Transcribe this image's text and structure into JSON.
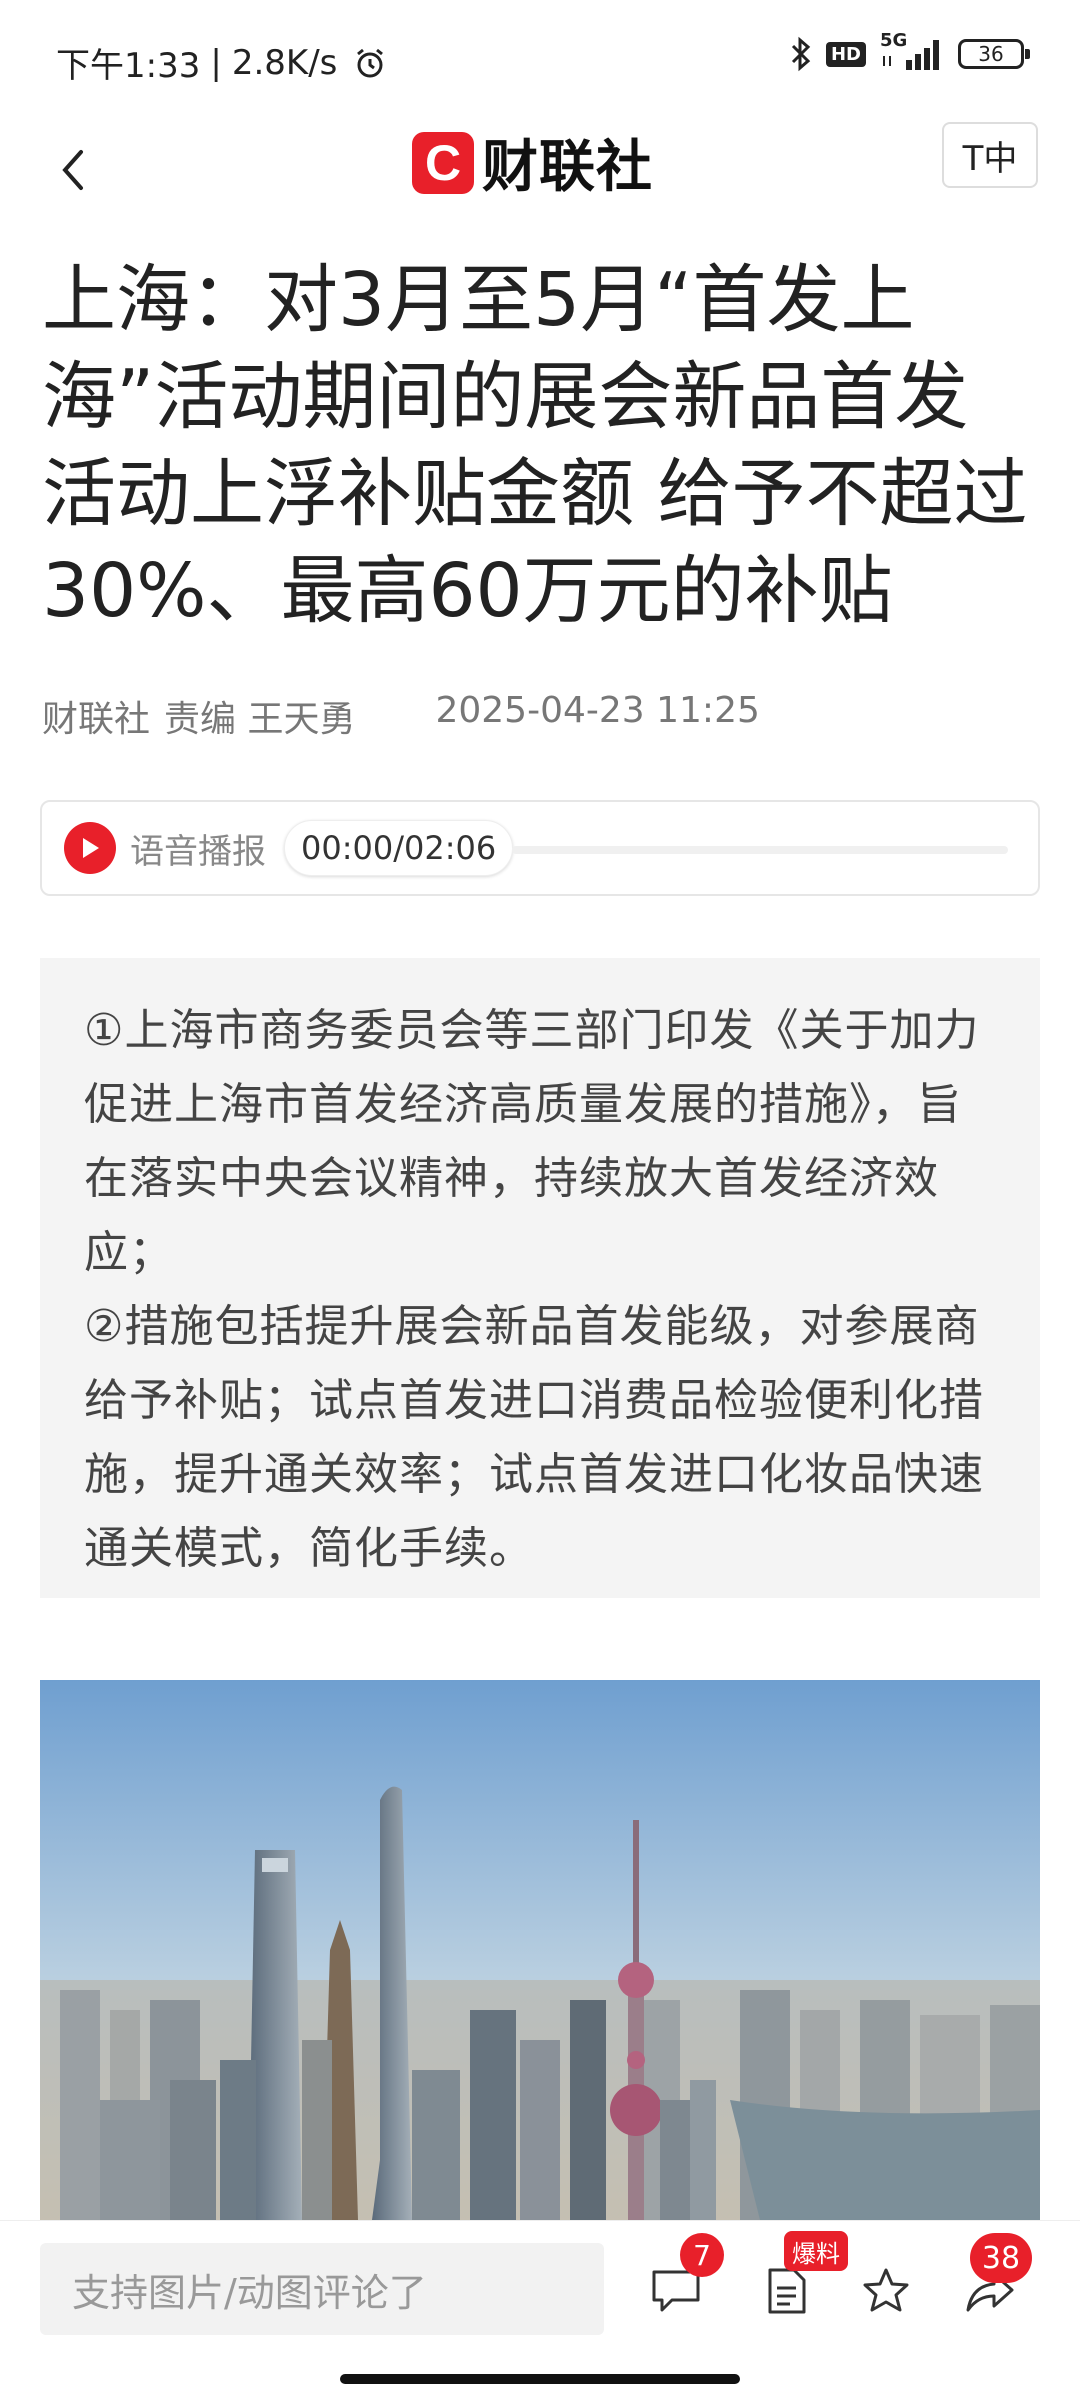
{
  "status_bar": {
    "time": "下午1:33",
    "net_speed": "2.8K/s",
    "signal_label": "5G",
    "hd_label": "HD",
    "battery": "36"
  },
  "header": {
    "logo_letter": "C",
    "logo_text": "财联社",
    "font_size_button": "T中"
  },
  "article": {
    "title": "上海：对3月至5月“首发上海”活动期间的展会新品首发活动上浮补贴金额 给予不超过30%、最高60万元的补贴",
    "source": "财联社",
    "editor": "责编 王天勇",
    "datetime": "2025-04-23 11:25"
  },
  "audio": {
    "label": "语音播报",
    "time": "00:00/02:06",
    "progress": 0
  },
  "summary": {
    "paragraphs": [
      "①上海市商务委员会等三部门印发《关于加力促进上海市首发经济高质量发展的措施》，旨在落实中央会议精神，持续放大首发经济效应；",
      "②措施包括提升展会新品首发能级，对参展商给予补贴；试点首发进口消费品检验便利化措施，提升通关效率；试点首发进口化妆品快速通关模式，简化手续。"
    ]
  },
  "bottom_bar": {
    "comment_placeholder": "支持图片/动图评论了",
    "comment_count": "7",
    "report_badge": "爆料",
    "share_count": "38"
  },
  "colors": {
    "brand_red": "#e8202a",
    "summary_bg": "#f4f4f4"
  }
}
